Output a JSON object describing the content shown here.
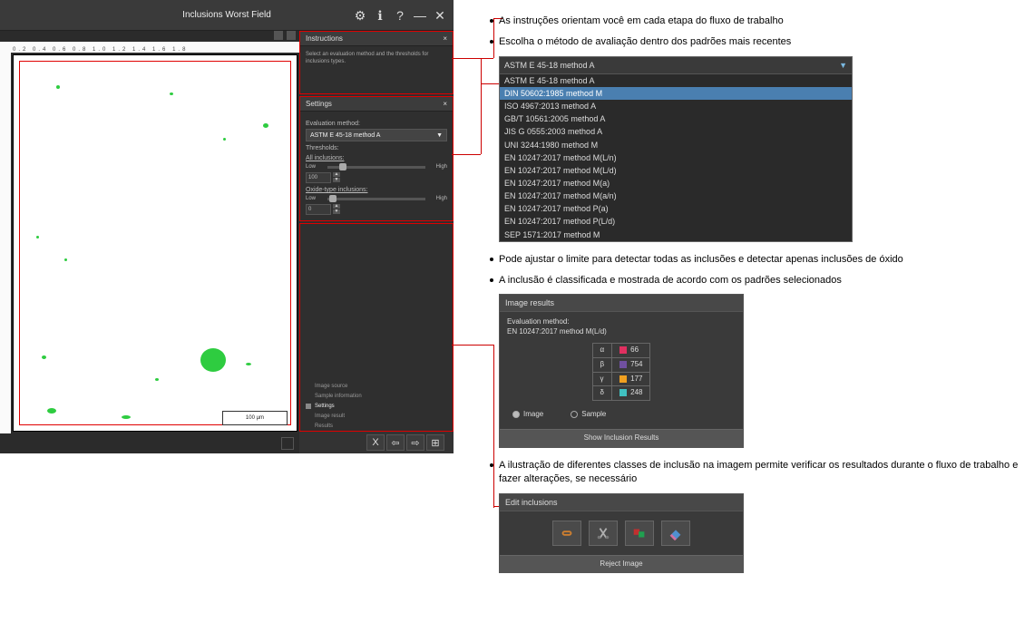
{
  "app": {
    "title": "Inclusions Worst Field",
    "titlebar_icons": [
      "gear-icon",
      "info-icon",
      "help-icon",
      "minimize-icon",
      "close-icon"
    ],
    "scalebar": "100 µm",
    "instructions": {
      "header": "Instructions",
      "text": "Select an evaluation method and the thresholds for inclusions types."
    },
    "settings": {
      "header": "Settings",
      "eval_label": "Evaluation method:",
      "eval_value": "ASTM E 45-18 method A",
      "thresholds_label": "Thresholds:",
      "all_label": "All inclusions:",
      "low": "Low",
      "high": "High",
      "all_value": "100",
      "oxide_label": "Oxide-type inclusions:",
      "oxide_value": "0"
    },
    "tasks": {
      "items": [
        "Image source",
        "Sample information",
        "Settings",
        "Image result",
        "Results"
      ]
    },
    "nav": {
      "close": "X",
      "back": "⇦",
      "fwd": "⇨",
      "extra": "⊞"
    }
  },
  "notes": {
    "n1": "As instruções orientam você em cada etapa do fluxo de trabalho",
    "n2": "Escolha o método de avaliação dentro dos padrões mais recentes",
    "n3": "Pode ajustar o limite para detectar todas as inclusões e detectar apenas inclusões de óxido",
    "n4": "A inclusão é classificada e mostrada de acordo com os padrões selecionados",
    "n5": "A ilustração de diferentes classes de inclusão na imagem permite verificar os resultados durante o fluxo de trabalho e fazer alterações, se necessário"
  },
  "dropdown": {
    "selected": "ASTM E 45-18 method A",
    "options": [
      "ASTM E 45-18 method A",
      "DIN 50602:1985 method M",
      "ISO 4967:2013 method A",
      "GB/T 10561:2005 method A",
      "JIS G 0555:2003 method A",
      "UNI 3244:1980 method M",
      "EN 10247:2017 method M(L/n)",
      "EN 10247:2017 method M(L/d)",
      "EN 10247:2017 method M(a)",
      "EN 10247:2017 method M(a/n)",
      "EN 10247:2017 method P(a)",
      "EN 10247:2017 method P(L/d)",
      "SEP 1571:2017 method M"
    ],
    "highlight_index": 1
  },
  "results": {
    "header": "Image results",
    "eval_label": "Evaluation method:",
    "eval_value": "EN 10247:2017 method M(L/d)",
    "rows": [
      {
        "sym": "α",
        "color": "#e03060",
        "val": "66"
      },
      {
        "sym": "β",
        "color": "#7050a0",
        "val": "754"
      },
      {
        "sym": "γ",
        "color": "#f0a020",
        "val": "177"
      },
      {
        "sym": "δ",
        "color": "#40c0c0",
        "val": "248"
      }
    ],
    "radio_image": "Image",
    "radio_sample": "Sample",
    "show_btn": "Show Inclusion Results"
  },
  "edit": {
    "header": "Edit inclusions",
    "reject_btn": "Reject Image",
    "tools": [
      "link-tool",
      "cut-tool",
      "recolor-tool",
      "erase-tool"
    ]
  }
}
